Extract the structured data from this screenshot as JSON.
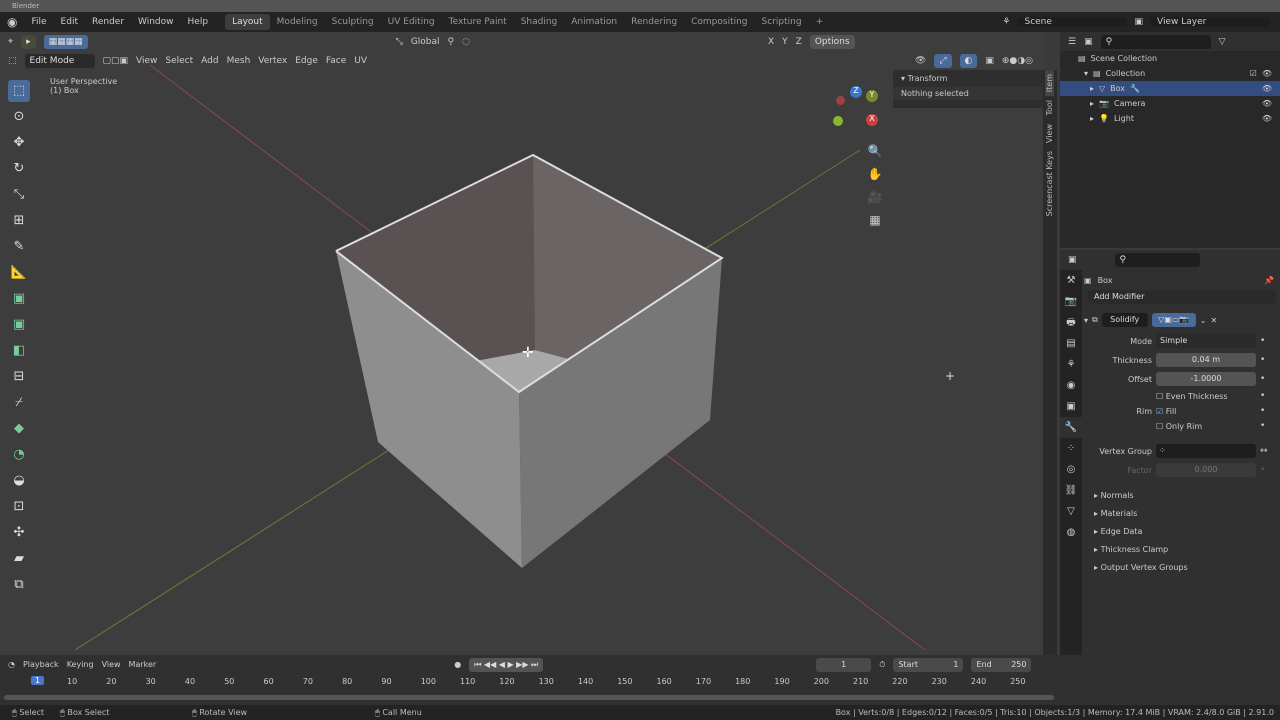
{
  "window": {
    "title": "Blender"
  },
  "menu": [
    "File",
    "Edit",
    "Render",
    "Window",
    "Help"
  ],
  "workspaces": [
    "Layout",
    "Modeling",
    "Sculpting",
    "UV Editing",
    "Texture Paint",
    "Shading",
    "Animation",
    "Rendering",
    "Compositing",
    "Scripting"
  ],
  "scene": "Scene",
  "view_layer": "View Layer",
  "viewport": {
    "mode": "Edit Mode",
    "menus": [
      "View",
      "Select",
      "Add",
      "Mesh",
      "Vertex",
      "Edge",
      "Face",
      "UV"
    ],
    "orientation": "Global",
    "options": "Options",
    "axes": [
      "X",
      "Y",
      "Z"
    ],
    "overlay_title": "User Perspective",
    "overlay_sub": "(1) Box",
    "gizmo": {
      "x": "X",
      "y": "Y",
      "z": "Z"
    }
  },
  "sidebar": {
    "tabs": [
      "Item",
      "Tool",
      "View",
      "Screencast Keys"
    ],
    "panel": "Transform",
    "msg": "Nothing selected"
  },
  "outliner": {
    "root": "Scene Collection",
    "items": [
      {
        "name": "Collection"
      },
      {
        "name": "Box"
      },
      {
        "name": "Camera"
      },
      {
        "name": "Light"
      }
    ]
  },
  "properties": {
    "object": "Box",
    "add_modifier": "Add Modifier",
    "modifier": "Solidify",
    "mode_label": "Mode",
    "mode": "Simple",
    "thickness_label": "Thickness",
    "thickness": "0.04 m",
    "offset_label": "Offset",
    "offset": "-1.0000",
    "even": "Even Thickness",
    "rim_label": "Rim",
    "fill": "Fill",
    "only_rim": "Only Rim",
    "vgroup_label": "Vertex Group",
    "factor_label": "Factor",
    "factor": "0.000",
    "subpanels": [
      "Normals",
      "Materials",
      "Edge Data",
      "Thickness Clamp",
      "Output Vertex Groups"
    ]
  },
  "timeline": {
    "menus": [
      "Playback",
      "Keying",
      "View",
      "Marker"
    ],
    "current": "1",
    "start_label": "Start",
    "start": "1",
    "end_label": "End",
    "end": "250",
    "ticks": [
      "10",
      "20",
      "30",
      "40",
      "50",
      "60",
      "70",
      "80",
      "90",
      "100",
      "110",
      "120",
      "130",
      "140",
      "150",
      "160",
      "170",
      "180",
      "190",
      "200",
      "210",
      "220",
      "230",
      "240",
      "250"
    ],
    "frame": "1"
  },
  "status": {
    "select": "Select",
    "box_select": "Box Select",
    "rotate": "Rotate View",
    "call_menu": "Call Menu",
    "stats": "Box | Verts:0/8 | Edges:0/12 | Faces:0/5 | Tris:10 | Objects:1/3 | Memory: 17.4 MiB | VRAM: 2.4/8.0 GiB | 2.91.0"
  }
}
